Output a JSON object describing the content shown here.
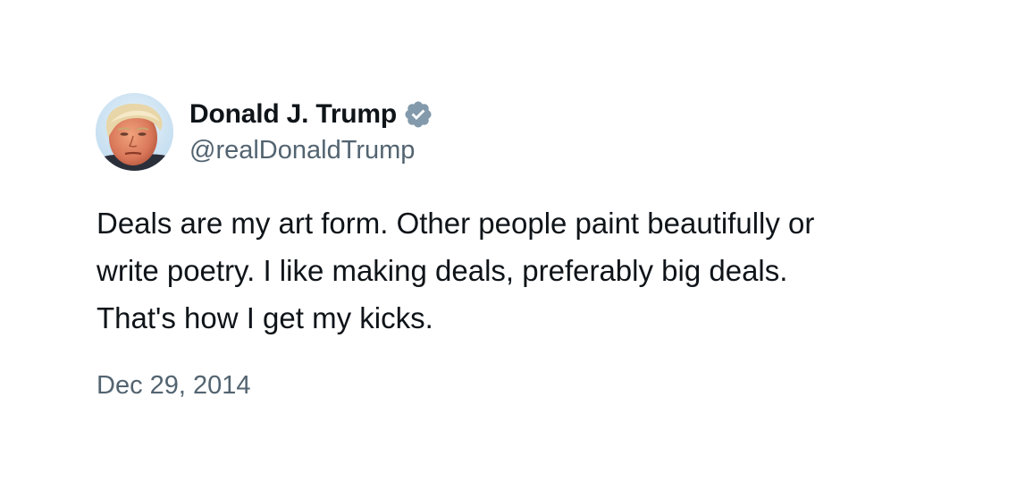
{
  "author": {
    "display_name": "Donald J. Trump",
    "handle": "@realDonaldTrump",
    "verified_icon": "verified-badge-icon",
    "verified_color": "#829aab",
    "avatar": "profile-photo"
  },
  "tweet": {
    "lines": [
      "Deals are my art form. Other people paint beautifully or",
      "write poetry. I like making deals, preferably big deals.",
      "That's how I get my kicks."
    ],
    "date": "Dec 29, 2014"
  },
  "colors": {
    "text_primary": "#0f1419",
    "text_secondary": "#536471",
    "background": "#ffffff"
  }
}
